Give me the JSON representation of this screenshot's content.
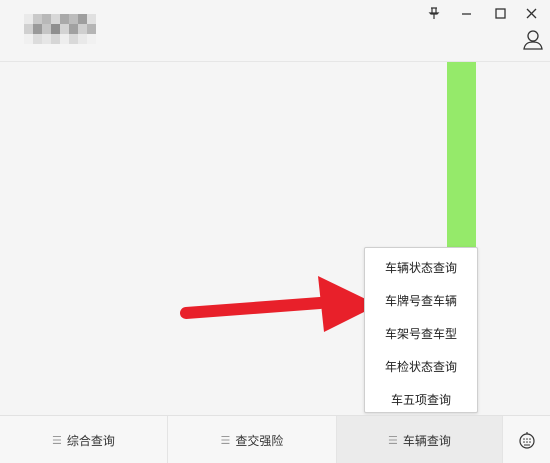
{
  "window": {
    "pin_icon": "pin-icon",
    "minimize_icon": "minimize-icon",
    "maximize_icon": "maximize-icon",
    "close_icon": "close-icon",
    "user_icon": "user-icon",
    "logo": "blurred-logo"
  },
  "colors": {
    "accent_green": "#95ea6a",
    "arrow_red": "#e8202a"
  },
  "popup_menu": {
    "items": [
      {
        "label": "车辆状态查询"
      },
      {
        "label": "车牌号查车辆"
      },
      {
        "label": "车架号查车型"
      },
      {
        "label": "年检状态查询"
      },
      {
        "label": "车五项查询"
      }
    ]
  },
  "bottom_nav": {
    "tabs": [
      {
        "label": "综合查询",
        "icon": "menu-icon"
      },
      {
        "label": "查交强险",
        "icon": "menu-icon"
      },
      {
        "label": "车辆查询",
        "icon": "menu-icon"
      }
    ],
    "keyboard_icon": "keyboard-icon"
  }
}
